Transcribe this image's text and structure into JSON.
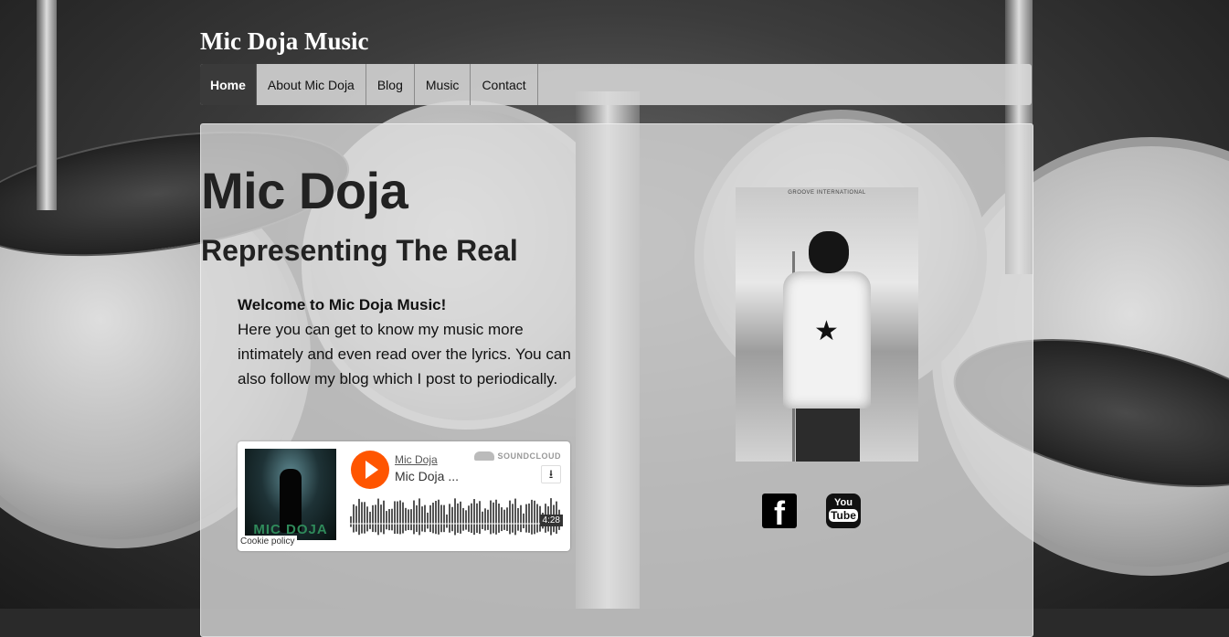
{
  "site": {
    "title": "Mic Doja Music"
  },
  "nav": {
    "items": [
      {
        "label": "Home",
        "active": true
      },
      {
        "label": "About Mic Doja",
        "active": false
      },
      {
        "label": "Blog",
        "active": false
      },
      {
        "label": "Music",
        "active": false
      },
      {
        "label": "Contact",
        "active": false
      }
    ]
  },
  "hero": {
    "name": "Mic Doja",
    "tagline": "Representing The Real",
    "welcome_heading": "Welcome to Mic Doja Music!",
    "welcome_body": "Here you can get to know my music more intimately and even read over the lyrics. You can also follow my blog which I post to periodically."
  },
  "soundcloud": {
    "artist": "Mic Doja",
    "track": "Mic Doja ...",
    "brand": "SOUNDCLOUD",
    "duration": "4:28",
    "cover_text": "MIC DOJA",
    "cookie_label": "Cookie policy",
    "accent_color": "#ff5500",
    "download_icon": "download-icon"
  },
  "photo": {
    "caption": "GROOVE INTERNATIONAL"
  },
  "social": {
    "facebook_icon": "facebook-icon",
    "youtube_icon": "youtube-icon",
    "youtube_you": "You",
    "youtube_tube": "Tube"
  }
}
